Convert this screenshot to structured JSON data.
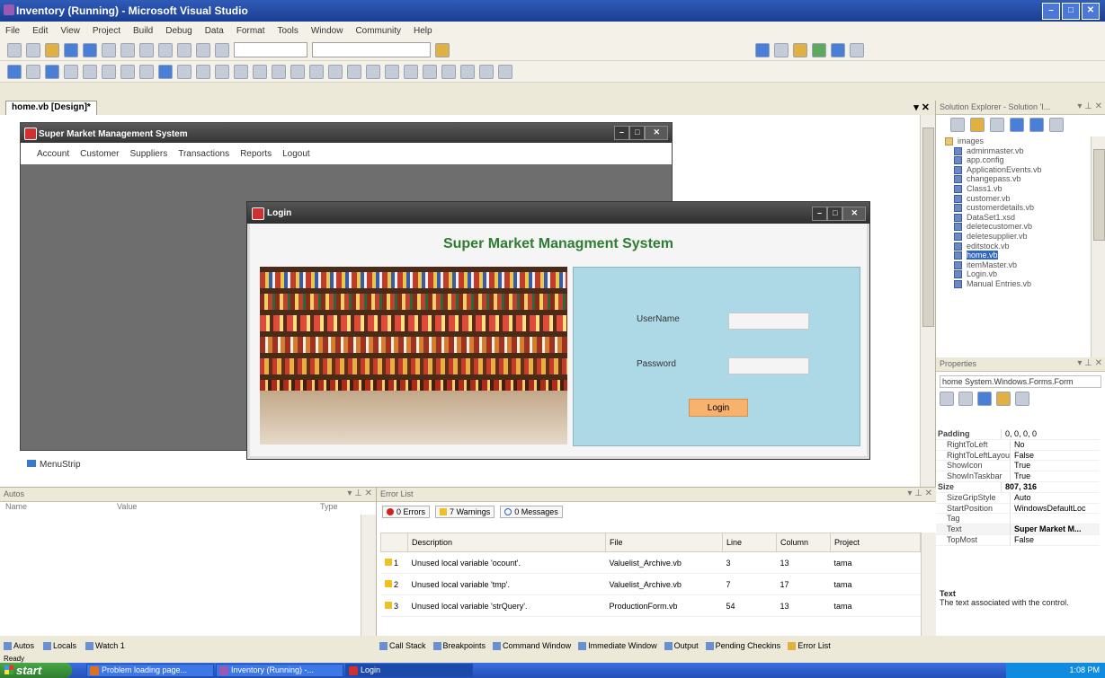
{
  "vs": {
    "title": "Inventory (Running) - Microsoft Visual Studio",
    "menu": [
      "File",
      "Edit",
      "View",
      "Project",
      "Build",
      "Debug",
      "Data",
      "Format",
      "Tools",
      "Window",
      "Community",
      "Help"
    ]
  },
  "doc_tab": "home.vb [Design]*",
  "mdi": {
    "title": "Super Market Management System",
    "menu": [
      "Account",
      "Customer",
      "Suppliers",
      "Transactions",
      "Reports",
      "Logout"
    ]
  },
  "menustrip_label": "MenuStrip",
  "login": {
    "title": "Login",
    "heading": "Super Market Managment System",
    "username_label": "UserName",
    "password_label": "Password",
    "button": "Login"
  },
  "solution_explorer": {
    "header": "Solution Explorer - Solution 'I...",
    "items": [
      "images",
      "adminmaster.vb",
      "app.config",
      "ApplicationEvents.vb",
      "changepass.vb",
      "Class1.vb",
      "customer.vb",
      "customerdetails.vb",
      "DataSet1.xsd",
      "deletecustomer.vb",
      "deletesupplier.vb",
      "editstock.vb",
      "home.vb",
      "itemMaster.vb",
      "Login.vb",
      "Manual Entries.vb"
    ]
  },
  "properties": {
    "header": "Properties",
    "object": "home System.Windows.Forms.Form",
    "rows": [
      {
        "name": "Padding",
        "value": "0, 0, 0, 0"
      },
      {
        "name": "RightToLeft",
        "value": "No"
      },
      {
        "name": "RightToLeftLayout",
        "value": "False"
      },
      {
        "name": "ShowIcon",
        "value": "True"
      },
      {
        "name": "ShowInTaskbar",
        "value": "True"
      },
      {
        "name": "Size",
        "value": "807, 316"
      },
      {
        "name": "SizeGripStyle",
        "value": "Auto"
      },
      {
        "name": "StartPosition",
        "value": "WindowsDefaultLoc"
      },
      {
        "name": "Tag",
        "value": ""
      },
      {
        "name": "Text",
        "value": "Super Market M..."
      },
      {
        "name": "TopMost",
        "value": "False"
      }
    ],
    "desc_title": "Text",
    "desc": "The text associated with the control."
  },
  "autos": {
    "header": "Autos",
    "cols": [
      "Name",
      "Value",
      "Type"
    ]
  },
  "error_list": {
    "header": "Error List",
    "filters": [
      "0 Errors",
      "7 Warnings",
      "0 Messages"
    ],
    "cols": [
      "",
      "Description",
      "File",
      "Line",
      "Column",
      "Project"
    ],
    "rows": [
      {
        "n": "1",
        "desc": "Unused local variable 'ocount'.",
        "file": "Valuelist_Archive.vb",
        "line": "3",
        "col": "13",
        "proj": "tama"
      },
      {
        "n": "2",
        "desc": "Unused local variable 'tmp'.",
        "file": "Valuelist_Archive.vb",
        "line": "7",
        "col": "17",
        "proj": "tama"
      },
      {
        "n": "3",
        "desc": "Unused local variable 'strQuery'.",
        "file": "ProductionForm.vb",
        "line": "54",
        "col": "13",
        "proj": "tama"
      }
    ]
  },
  "bottom_tabs_left": [
    "Autos",
    "Locals",
    "Watch 1"
  ],
  "bottom_tabs_right": [
    "Call Stack",
    "Breakpoints",
    "Command Window",
    "Immediate Window",
    "Output",
    "Pending Checkins",
    "Error List"
  ],
  "status": "Ready",
  "taskbar": {
    "start": "start",
    "tasks": [
      "Problem loading page...",
      "Inventory (Running) -...",
      "Login"
    ],
    "clock": "1:08 PM"
  }
}
